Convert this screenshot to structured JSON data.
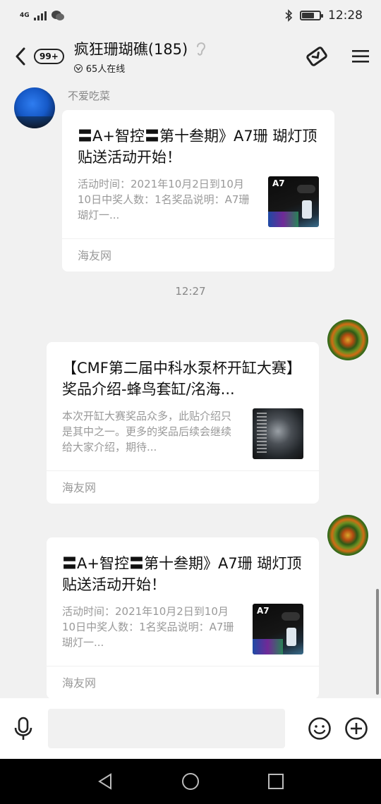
{
  "status_bar": {
    "network_label": "4G",
    "time": "12:28",
    "icons": [
      "signal-icon",
      "wechat-icon",
      "bluetooth-icon",
      "battery-icon"
    ]
  },
  "header": {
    "unread_badge": "99+",
    "title": "疯狂珊瑚礁(185)",
    "online_count": "65人在线"
  },
  "messages": [
    {
      "sender": "不爱吃菜",
      "card": {
        "title": "〓A+智控〓第十叁期》A7珊 瑚灯顶贴送活动开始！",
        "description": "活动时间：2021年10月2日到10月10日中奖人数：1名奖品说明：A7珊瑚灯一...",
        "thumb_label": "A7",
        "source": "海友网"
      }
    },
    {
      "timestamp": "12:27"
    },
    {
      "card": {
        "title": "【CMF第二届中科水泵杯开缸大赛】奖品介绍-蜂鸟套缸/洺海...",
        "description": "本次开缸大赛奖品众多，此贴介绍只是其中之一。更多的奖品后续会继续给大家介绍，期待...",
        "source": "海友网"
      }
    },
    {
      "card": {
        "title": "〓A+智控〓第十叁期》A7珊 瑚灯顶贴送活动开始！",
        "description": "活动时间：2021年10月2日到10月10日中奖人数：1名奖品说明：A7珊瑚灯一...",
        "thumb_label": "A7",
        "source": "海友网"
      }
    }
  ],
  "input": {
    "placeholder": ""
  },
  "colors": {
    "background": "#f1f1f1",
    "card": "#ffffff",
    "muted_text": "#999999"
  }
}
